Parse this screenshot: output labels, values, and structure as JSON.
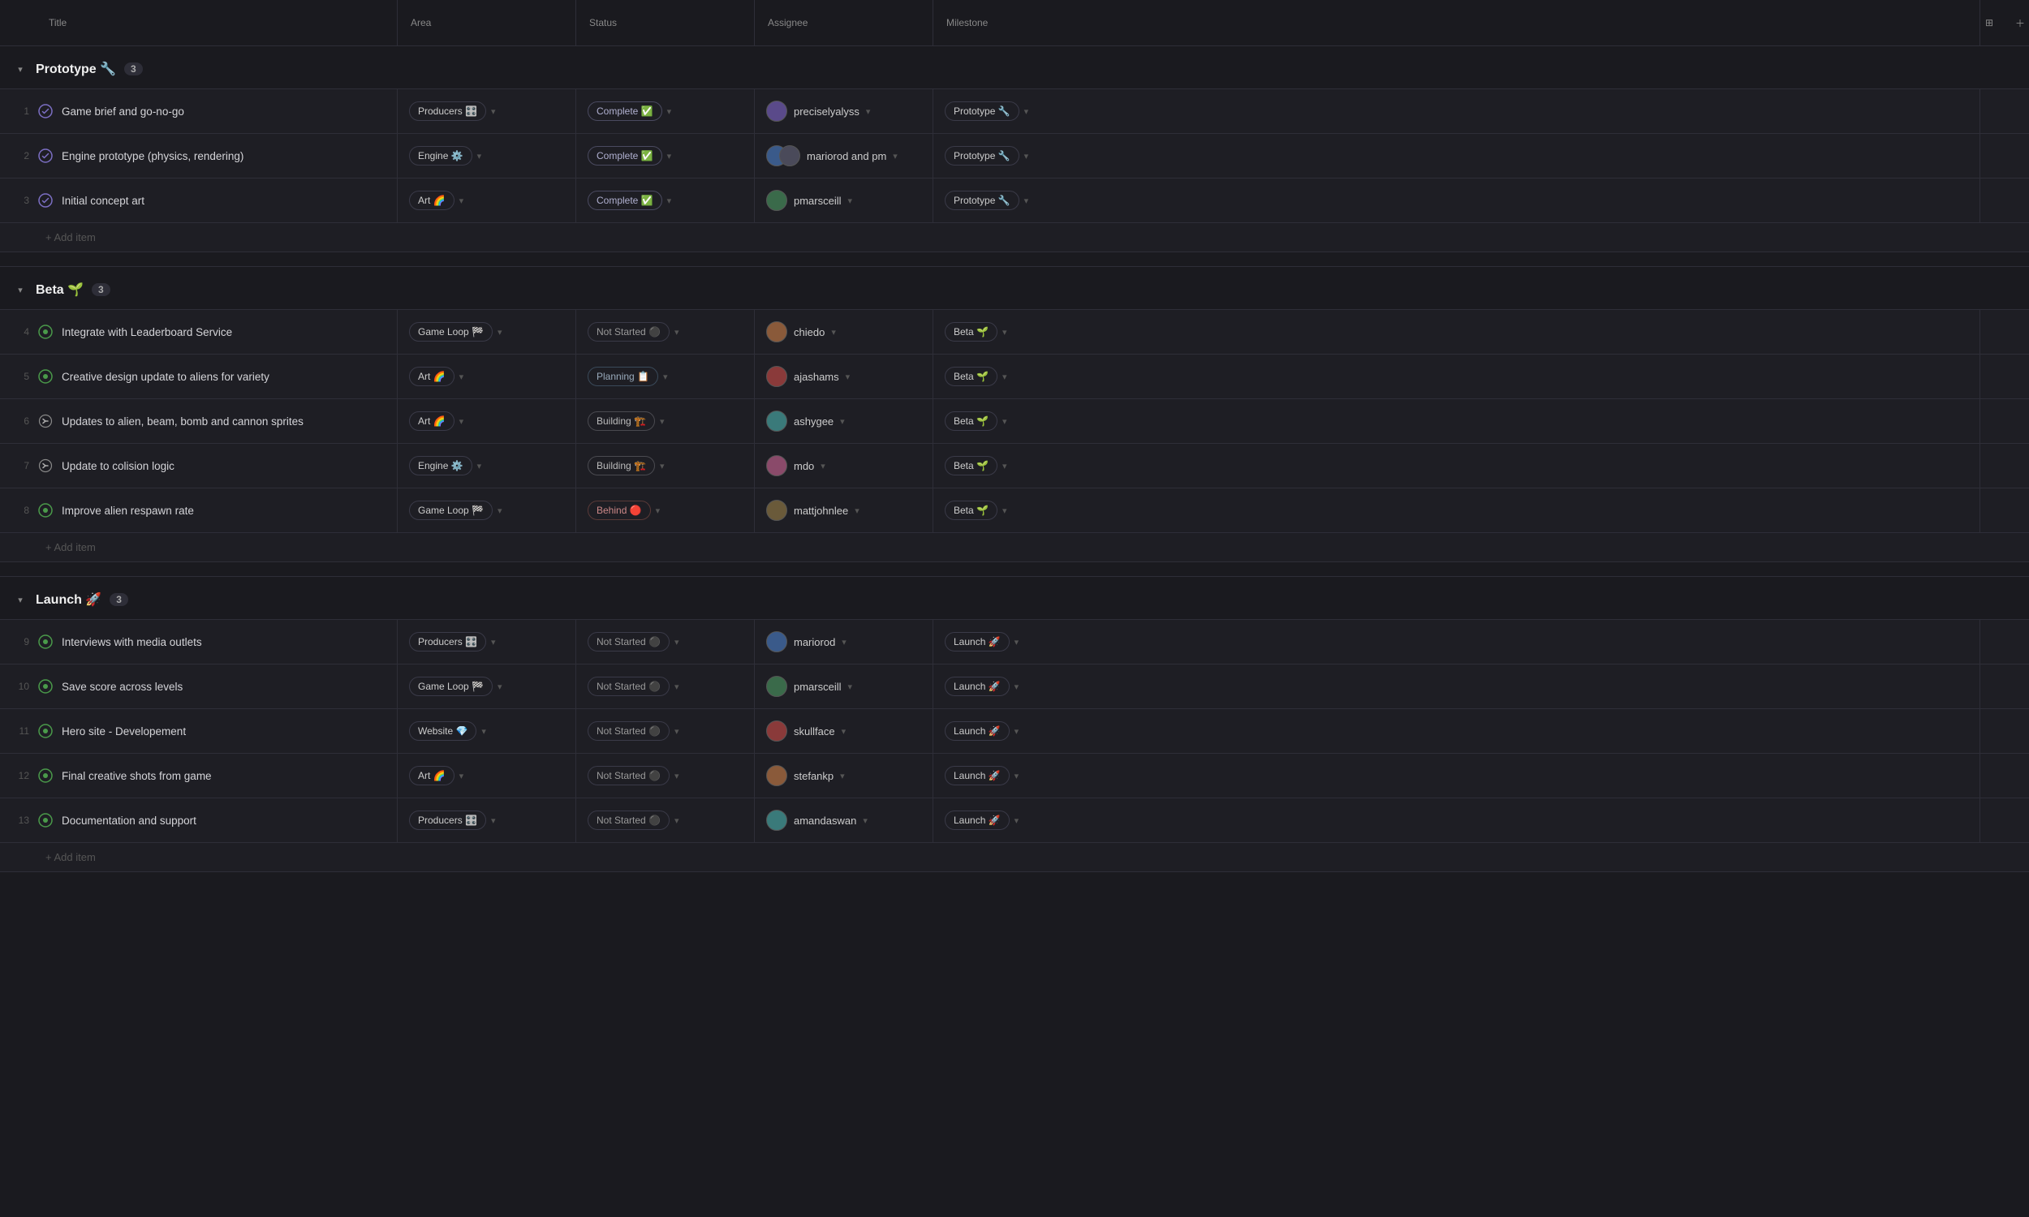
{
  "header": {
    "columns": [
      "Title",
      "Area",
      "Status",
      "Assignee",
      "Milestone",
      "",
      "+"
    ]
  },
  "groups": [
    {
      "id": "prototype",
      "title": "Prototype",
      "emoji": "🔧",
      "count": 3,
      "items": [
        {
          "num": 1,
          "statusIcon": "complete",
          "title": "Game brief and go-no-go",
          "area": "Producers 🎛️",
          "status": "Complete ✅",
          "statusType": "complete",
          "assignee": "preciselyalyss",
          "assigneeAvatar": "av-purple",
          "milestone": "Prototype 🔧"
        },
        {
          "num": 2,
          "statusIcon": "complete",
          "title": "Engine prototype (physics, rendering)",
          "area": "Engine ⚙️",
          "status": "Complete ✅",
          "statusType": "complete",
          "assignee": "mariorod and pm",
          "assigneeAvatar": "av-blue",
          "assigneeAvatar2": "av-gray",
          "hasPair": true,
          "milestone": "Prototype 🔧"
        },
        {
          "num": 3,
          "statusIcon": "complete",
          "title": "Initial concept art",
          "area": "Art 🌈",
          "status": "Complete ✅",
          "statusType": "complete",
          "assignee": "pmarsceill",
          "assigneeAvatar": "av-green",
          "milestone": "Prototype 🔧"
        }
      ]
    },
    {
      "id": "beta",
      "title": "Beta",
      "emoji": "🌱",
      "count": 3,
      "items": [
        {
          "num": 4,
          "statusIcon": "circle",
          "title": "Integrate with Leaderboard Service",
          "area": "Game Loop 🏁",
          "status": "Not Started ⚫",
          "statusType": "not-started",
          "assignee": "chiedo",
          "assigneeAvatar": "av-orange",
          "milestone": "Beta 🌱"
        },
        {
          "num": 5,
          "statusIcon": "circle",
          "title": "Creative design update to aliens for variety",
          "area": "Art 🌈",
          "status": "Planning 📋",
          "statusType": "planning",
          "assignee": "ajashams",
          "assigneeAvatar": "av-red",
          "milestone": "Beta 🌱"
        },
        {
          "num": 6,
          "statusIcon": "split",
          "title": "Updates to alien, beam, bomb and cannon sprites",
          "area": "Art 🌈",
          "status": "Building 🏗️",
          "statusType": "building",
          "assignee": "ashygee",
          "assigneeAvatar": "av-teal",
          "milestone": "Beta 🌱"
        },
        {
          "num": 7,
          "statusIcon": "split",
          "title": "Update to colision logic",
          "area": "Engine ⚙️",
          "status": "Building 🏗️",
          "statusType": "building",
          "assignee": "mdo",
          "assigneeAvatar": "av-pink",
          "milestone": "Beta 🌱"
        },
        {
          "num": 8,
          "statusIcon": "circle",
          "title": "Improve alien respawn rate",
          "area": "Game Loop 🏁",
          "status": "Behind 🔴",
          "statusType": "behind",
          "assignee": "mattjohnlee",
          "assigneeAvatar": "av-brown",
          "milestone": "Beta 🌱"
        }
      ]
    },
    {
      "id": "launch",
      "title": "Launch",
      "emoji": "🚀",
      "count": 3,
      "items": [
        {
          "num": 9,
          "statusIcon": "circle",
          "title": "Interviews with media outlets",
          "area": "Producers 🎛️",
          "status": "Not Started ⚫",
          "statusType": "not-started",
          "assignee": "mariorod",
          "assigneeAvatar": "av-blue",
          "milestone": "Launch 🚀"
        },
        {
          "num": 10,
          "statusIcon": "circle",
          "title": "Save score across levels",
          "area": "Game Loop 🏁",
          "status": "Not Started ⚫",
          "statusType": "not-started",
          "assignee": "pmarsceill",
          "assigneeAvatar": "av-green",
          "milestone": "Launch 🚀"
        },
        {
          "num": 11,
          "statusIcon": "circle",
          "title": "Hero site - Developement",
          "area": "Website 💎",
          "status": "Not Started ⚫",
          "statusType": "not-started",
          "assignee": "skullface",
          "assigneeAvatar": "av-red",
          "milestone": "Launch 🚀"
        },
        {
          "num": 12,
          "statusIcon": "circle",
          "title": "Final creative shots from game",
          "area": "Art 🌈",
          "status": "Not Started ⚫",
          "statusType": "not-started",
          "assignee": "stefankp",
          "assigneeAvatar": "av-orange",
          "milestone": "Launch 🚀"
        },
        {
          "num": 13,
          "statusIcon": "circle",
          "title": "Documentation and support",
          "area": "Producers 🎛️",
          "status": "Not Started ⚫",
          "statusType": "not-started",
          "assignee": "amandaswan",
          "assigneeAvatar": "av-teal",
          "milestone": "Launch 🚀"
        }
      ]
    }
  ],
  "labels": {
    "add_item": "+ Add item"
  }
}
